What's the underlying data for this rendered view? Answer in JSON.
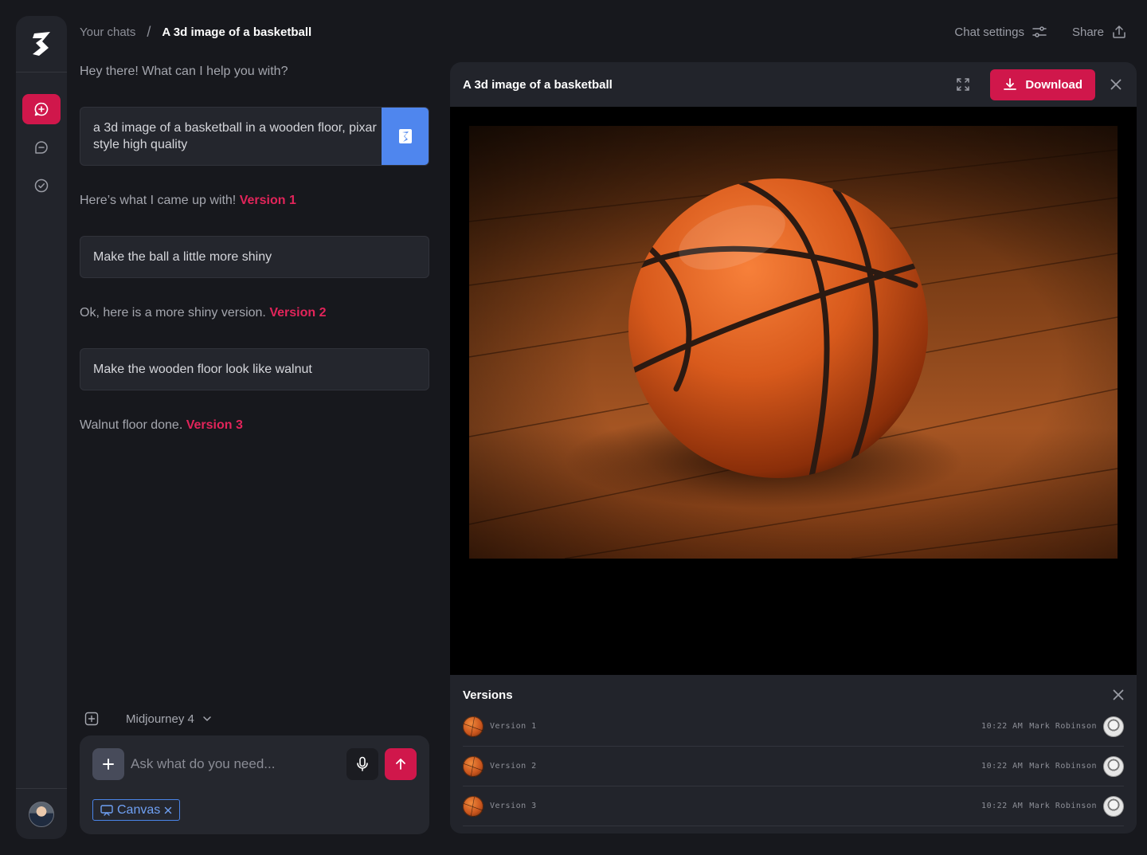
{
  "breadcrumb": {
    "root": "Your chats",
    "separator": "/",
    "current": "A 3d image of a basketball"
  },
  "header": {
    "chat_settings_label": "Chat settings",
    "share_label": "Share"
  },
  "sidebar": {
    "items": [
      {
        "icon": "new-chat-icon",
        "active": true
      },
      {
        "icon": "chats-icon",
        "active": false
      },
      {
        "icon": "tasks-check-icon",
        "active": false
      }
    ]
  },
  "chat": {
    "greeting": "Hey there! What can I help you with?",
    "user_prompt_1": "a 3d image of a basketball in a wooden floor, pixar style high quality",
    "reply_1_text": "Here’s what I came up with!",
    "reply_1_version": "Version 1",
    "user_prompt_2": "Make the ball a little more shiny",
    "reply_2_text": "Ok, here is a more shiny version.",
    "reply_2_version": "Version 2",
    "user_prompt_3": "Make the wooden floor look like walnut",
    "reply_3_text": "Walnut floor done.",
    "reply_3_version": "Version 3"
  },
  "composer": {
    "model": "Midjourney 4",
    "placeholder": "Ask what do you need...",
    "chip_label": "Canvas"
  },
  "panel": {
    "title": "A 3d image of a basketball",
    "download_label": "Download",
    "versions_title": "Versions",
    "versions": [
      {
        "label": "Version 1",
        "time": "10:22 AM",
        "user": "Mark Robinson"
      },
      {
        "label": "Version 2",
        "time": "10:22 AM",
        "user": "Mark Robinson"
      },
      {
        "label": "Version 3",
        "time": "10:22 AM",
        "user": "Mark Robinson"
      }
    ]
  },
  "colors": {
    "accent": "#d0174b",
    "accent_text": "#e2245a",
    "attachment_blue": "#4f86ee",
    "background": "#17181d",
    "surface": "#22242b"
  }
}
